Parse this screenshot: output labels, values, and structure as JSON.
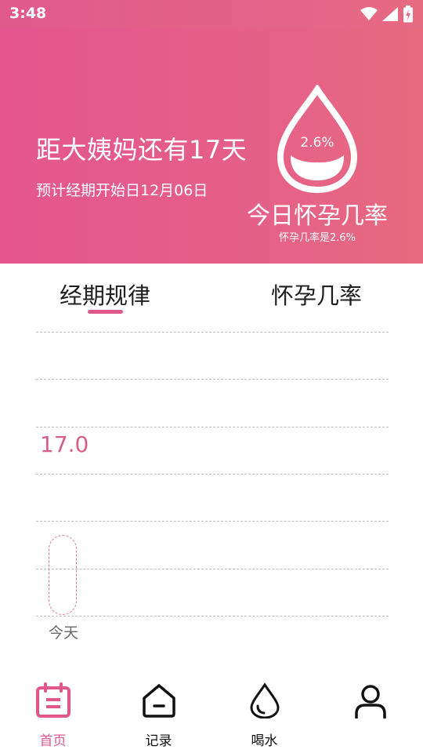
{
  "status_bar": {
    "time": "3:48",
    "icons": [
      "wifi-icon",
      "signal-icon",
      "battery-icon"
    ]
  },
  "header": {
    "countdown": "距大姨妈还有17天",
    "next_period": "预计经期开始日12月06日",
    "drop_percent": "2.6%",
    "pregnancy_title": "今日怀孕几率",
    "pregnancy_sub": "怀孕几率是2.6%"
  },
  "tabs": [
    {
      "label": "经期规律",
      "active": true
    },
    {
      "label": "怀孕几率",
      "active": false
    }
  ],
  "chart": {
    "value_label": "17.0",
    "today_label": "今天"
  },
  "nav": {
    "items": [
      {
        "label": "首页",
        "icon": "calendar-icon",
        "active": true
      },
      {
        "label": "记录",
        "icon": "home-record-icon",
        "active": false
      },
      {
        "label": "喝水",
        "icon": "water-drop-icon",
        "active": false
      },
      {
        "label": "",
        "icon": "user-icon",
        "active": false
      }
    ]
  },
  "colors": {
    "accent": "#e0588b",
    "header_start": "#e4568c",
    "header_end": "#e76a7e"
  }
}
